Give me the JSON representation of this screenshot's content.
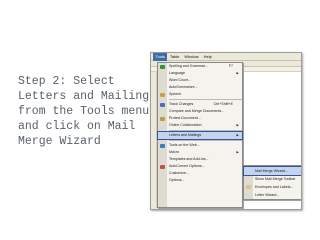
{
  "caption": "Step 2: Select\nLetters and Mailings\nfrom the Tools menu\nand click on Mail\nMerge Wizard",
  "colors": {
    "caption": "#58606b",
    "highlight": "#c6d3ef",
    "highlight_border": "#31569c",
    "menubar": "#ece9d8"
  },
  "menubar": {
    "items": [
      {
        "label": "Tools",
        "active": true
      },
      {
        "label": "Table"
      },
      {
        "label": "Window"
      },
      {
        "label": "Help"
      }
    ]
  },
  "tools_menu": {
    "items": [
      {
        "label": "Spelling and Grammar...",
        "shortcut": "F7",
        "icon": "spelling-icon"
      },
      {
        "label": "Language",
        "submenu": true
      },
      {
        "label": "Word Count..."
      },
      {
        "label": "AutoSummarize..."
      },
      {
        "label": "Speech",
        "icon": "speech-icon"
      },
      {
        "label": "Track Changes",
        "shortcut": "Ctrl+Shift+E",
        "icon": "track-changes-icon"
      },
      {
        "label": "Compare and Merge Documents..."
      },
      {
        "label": "Protect Document...",
        "icon": "protect-icon"
      },
      {
        "label": "Online Collaboration",
        "submenu": true
      },
      {
        "label": "Letters and Mailings",
        "submenu": true,
        "highlight": true
      },
      {
        "label": "Tools on the Web...",
        "icon": "web-icon"
      },
      {
        "label": "Macro",
        "submenu": true
      },
      {
        "label": "Templates and Add-Ins..."
      },
      {
        "label": "AutoCorrect Options...",
        "icon": "autocorrect-icon"
      },
      {
        "label": "Customize..."
      },
      {
        "label": "Options..."
      }
    ]
  },
  "submenu": {
    "items": [
      {
        "label": "Mail Merge Wizard...",
        "highlight": true
      },
      {
        "label": "Show Mail Merge Toolbar"
      },
      {
        "label": "Envelopes and Labels...",
        "icon": "envelope-icon"
      },
      {
        "label": "Letter Wizard..."
      }
    ]
  }
}
